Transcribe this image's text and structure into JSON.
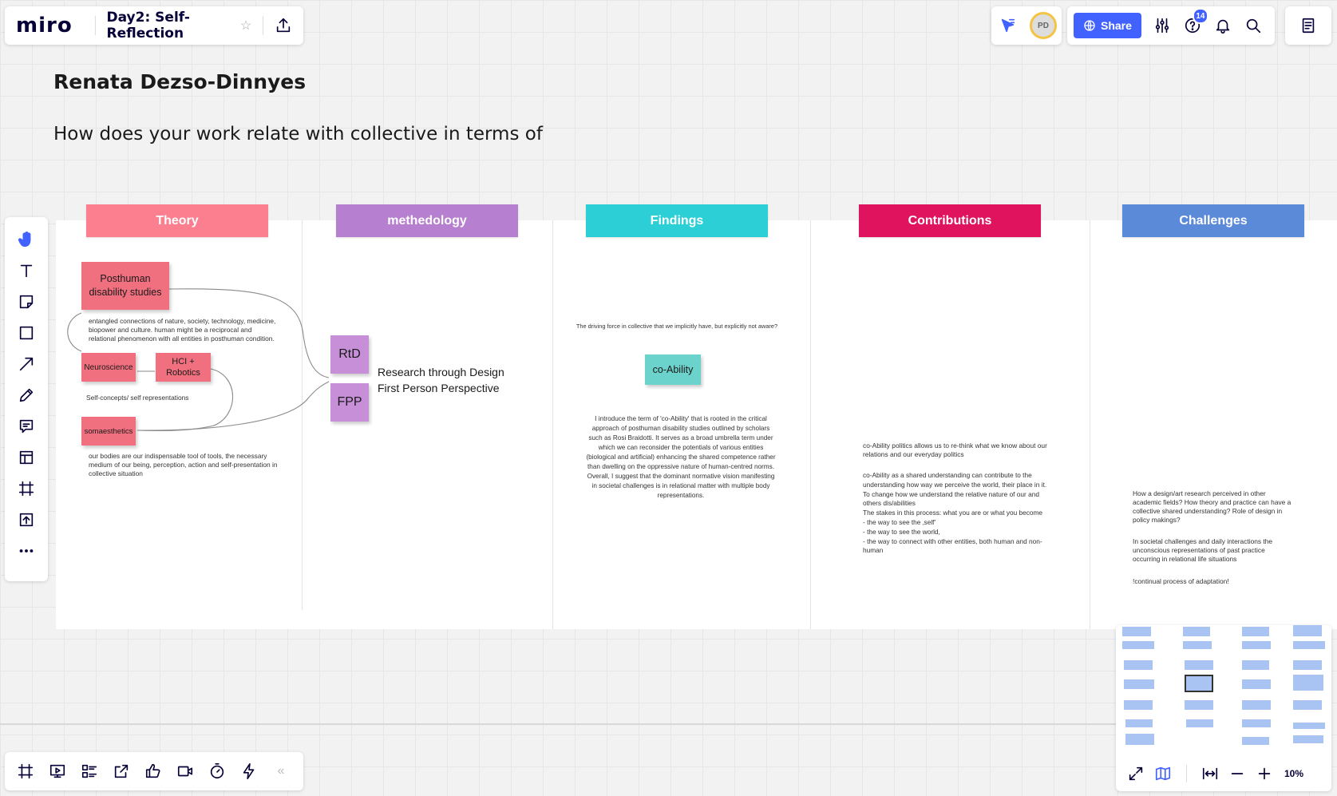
{
  "topbar": {
    "logo": "miro",
    "board_title": "Day2: Self-Reflection",
    "share_label": "Share",
    "avatar_initials": "PD",
    "help_badge": "14"
  },
  "board": {
    "author": "Renata Dezso-Dinnyes",
    "question": "How does your work relate with collective in terms of",
    "columns": [
      {
        "label": "Theory",
        "color": "#fb7f8e"
      },
      {
        "label": "methedology",
        "color": "#b67fcf"
      },
      {
        "label": "Findings",
        "color": "#2dcfd6"
      },
      {
        "label": "Contributions",
        "color": "#e0135e"
      },
      {
        "label": "Challenges",
        "color": "#5b8ad9"
      }
    ],
    "theory": {
      "sticky_posthuman": "Posthuman disability studies",
      "text_entangled": "entangled connections of nature, society, technology, medicine, biopower and culture. human might be a reciprocal and relational phenomenon with all entities in posthuman condition.",
      "sticky_neuroscience": "Neuroscience",
      "sticky_hci": "HCI + Robotics",
      "text_selfconcepts": "Self-concepts/ self representations",
      "sticky_soma": "somaesthetics",
      "text_bodies": "our bodies are our indispensable tool of tools, the necessary medium of our being, perception, action and self-presentation in collective situation"
    },
    "methodology": {
      "sticky_rtd": "RtD",
      "sticky_fpp": "FPP",
      "text_line1": "Research through Design",
      "text_line2": "First Person Perspective"
    },
    "findings": {
      "text_driving": "The driving force in collective that we implicitly have, but explicitly not aware?",
      "sticky_coability": "co-Ability",
      "text_intro": "I introduce the term of 'co-Ability' that is rooted in the critical approach of posthuman disability studies outlined by scholars such as Rosi Braidotti. It serves as a broad umbrella term under which we can reconsider the potentials of various entities (biological and artificial) enhancing the shared competence rather than dwelling on the oppressive nature of human-centred norms. Overall, I suggest that the dominant normative vision manifesting in societal challenges is in relational matter with multiple body representations."
    },
    "contributions": {
      "text_1": "co-Ability politics allows us to re-think what we know about our relations and our everyday politics",
      "text_2": "co-Ability as a shared understanding can contribute to the understanding how way we perceive the world, their place in it.\nTo change how we understand the relative nature of our and others dis/abilities\nThe stakes in this process: what you are or what you become\n- the way to see the ‚self'\n- the way to see the world,\n  - the way to connect with other entities, both human and non-human"
    },
    "challenges": {
      "text_1": "How a design/art research perceived in other academic fields?  How theory and practice can have a collective shared understanding? Role of design in policy makings?",
      "text_2": "In societal challenges and daily interactions the unconscious representations of past practice occurring in relational life situations",
      "text_3": "!continual process of adaptation!"
    }
  },
  "toolbar_left": [
    "hand-icon",
    "text-icon",
    "sticky-note-icon",
    "shape-icon",
    "arrow-icon",
    "pen-icon",
    "comment-icon",
    "template-icon",
    "frame-icon",
    "upload-icon",
    "more-icon"
  ],
  "toolbar_bottom": [
    "frame-icon",
    "present-icon",
    "list-icon",
    "share-screen-icon",
    "like-icon",
    "video-icon",
    "timer-icon",
    "lightning-icon",
    "collapse-icon"
  ],
  "zoom": {
    "level": "10%"
  }
}
